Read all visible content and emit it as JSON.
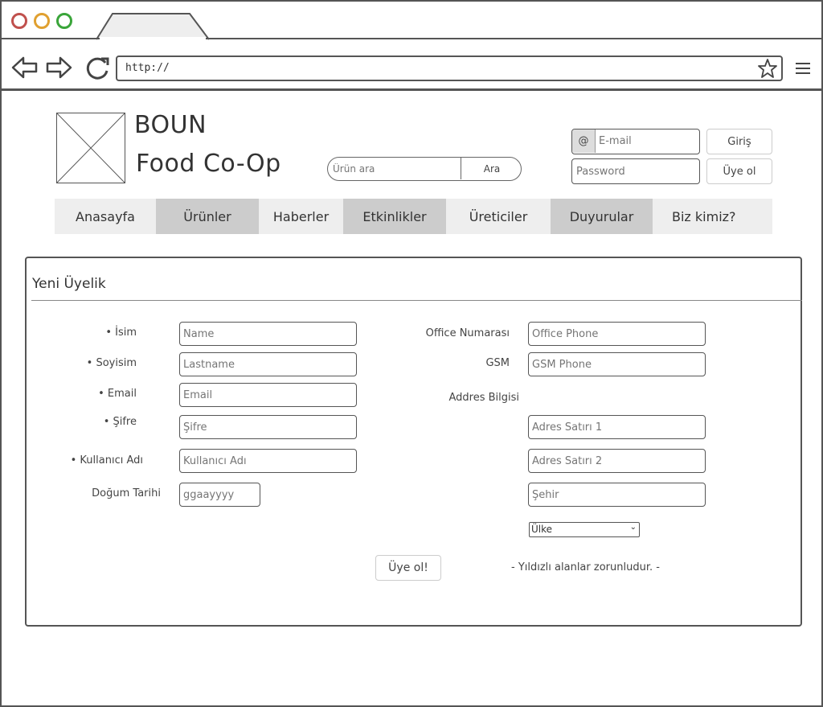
{
  "browser": {
    "url": "http://"
  },
  "header": {
    "brand_line1": "BOUN",
    "brand_line2": "Food Co-Op",
    "search_placeholder": "Ürün ara",
    "search_button": "Ara",
    "email_placeholder": "E-mail",
    "at_symbol": "@",
    "password_placeholder": "Password",
    "login_button": "Giriş",
    "signup_button": "Üye ol"
  },
  "menu": {
    "items": [
      {
        "label": "Anasayfa",
        "active": false
      },
      {
        "label": "Ürünler",
        "active": true
      },
      {
        "label": "Haberler",
        "active": false
      },
      {
        "label": "Etkinlikler",
        "active": true
      },
      {
        "label": "Üreticiler",
        "active": false
      },
      {
        "label": "Duyurular",
        "active": true
      },
      {
        "label": "Biz kimiz?",
        "active": false
      }
    ]
  },
  "form": {
    "title": "Yeni Üyelik",
    "left": {
      "name_label": "• İsim",
      "name_placeholder": "Name",
      "lastname_label": "• Soyisim",
      "lastname_placeholder": "Lastname",
      "email_label": "• Email",
      "email_placeholder": "Email",
      "password_label": "• Şifre",
      "password_placeholder": "Şifre",
      "username_label": "• Kullanıcı Adı",
      "username_placeholder": "Kullanıcı Adı",
      "birthdate_label": "Doğum Tarihi",
      "birthdate_placeholder": "ggaayyyy"
    },
    "right": {
      "office_label": "Office Numarası",
      "office_placeholder": "Office Phone",
      "gsm_label": "GSM",
      "gsm_placeholder": "GSM Phone",
      "address_label": "Addres Bilgisi",
      "address1_placeholder": "Adres Satırı 1",
      "address2_placeholder": "Adres Satırı 2",
      "city_placeholder": "Şehir",
      "country_selected": "Ülke"
    },
    "submit_label": "Üye ol!",
    "required_note": "- Yıldızlı alanlar zorunludur. -"
  },
  "colors": {
    "stroke": "#555555",
    "menu_bg": "#eeeeee",
    "menu_active_bg": "#cccccc",
    "traffic_red": "#c0504d",
    "traffic_orange": "#e0a030",
    "traffic_green": "#3aa53a"
  }
}
